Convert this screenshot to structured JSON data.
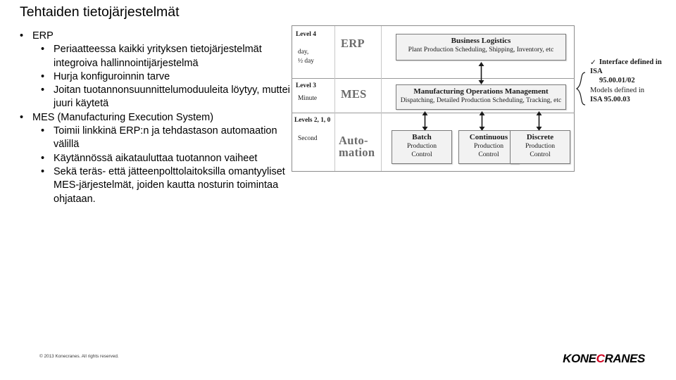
{
  "slide": {
    "title": "Tehtaiden tietojärjestelmät",
    "bullets": [
      {
        "level": 1,
        "marker": "•",
        "text": "ERP",
        "children": [
          {
            "level": 2,
            "marker": "•",
            "text": "Periaatteessa kaikki yrityksen tietojärjestelmät integroiva hallinnointijärjestelmä"
          },
          {
            "level": 2,
            "marker": "•",
            "text": "Hurja konfiguroinnin tarve"
          },
          {
            "level": 2,
            "marker": "•",
            "text": "Joitan tuotannonsuunnittelumoduuleita löytyy, muttei juuri käytetä"
          }
        ]
      },
      {
        "level": 1,
        "marker": "•",
        "text": "MES (Manufacturing Execution System)",
        "children": [
          {
            "level": 2,
            "marker": "•",
            "text": "Toimii linkkinä ERP:n ja tehdastason automaation välillä"
          },
          {
            "level": 2,
            "marker": "•",
            "text": "Käytännössä aikatauluttaa tuotannon vaiheet"
          },
          {
            "level": 2,
            "marker": "•",
            "text": "Sekä teräs- että jätteenpolttolaitoksilla omantyyliset MES-järjestelmät, joiden kautta nosturin toimintaa ohjataan."
          }
        ]
      }
    ]
  },
  "diagram": {
    "levels": [
      {
        "label": "Level 4",
        "sublabels": [
          "day,",
          "½ day"
        ],
        "tier": "ERP"
      },
      {
        "label": "Level 3",
        "sublabels": [
          "Minute"
        ],
        "tier": "MES"
      },
      {
        "label": "Levels 2, 1, 0",
        "sublabels": [
          "Second"
        ],
        "tier": "Auto-\nmation"
      }
    ],
    "level4_box": {
      "title": "Business Logistics",
      "subtitle": "Plant Production Scheduling, Shipping, Inventory, etc"
    },
    "level3_box": {
      "title": "Manufacturing Operations Management",
      "subtitle": "Dispatching, Detailed Production Scheduling, Tracking, etc"
    },
    "level2_boxes": [
      {
        "title": "Batch",
        "subtitle": "Production\nControl"
      },
      {
        "title": "Continuous",
        "subtitle": "Production\nControl"
      },
      {
        "title": "Discrete",
        "subtitle": "Production\nControl"
      }
    ],
    "annotations": [
      {
        "line1": "Interface defined in ISA",
        "line2": "95.00.01/02"
      },
      {
        "line1": "Models defined in",
        "line2": "ISA 95.00.03"
      }
    ]
  },
  "footer": {
    "copyright": "© 2013 Konecranes. All rights reserved.",
    "logo_part1": "KONE",
    "logo_part2": "C",
    "logo_part3": "RANES"
  },
  "colors": {
    "accent": "#d1001f",
    "box_fill": "#f2f2f2",
    "border": "#7a7a7a"
  }
}
